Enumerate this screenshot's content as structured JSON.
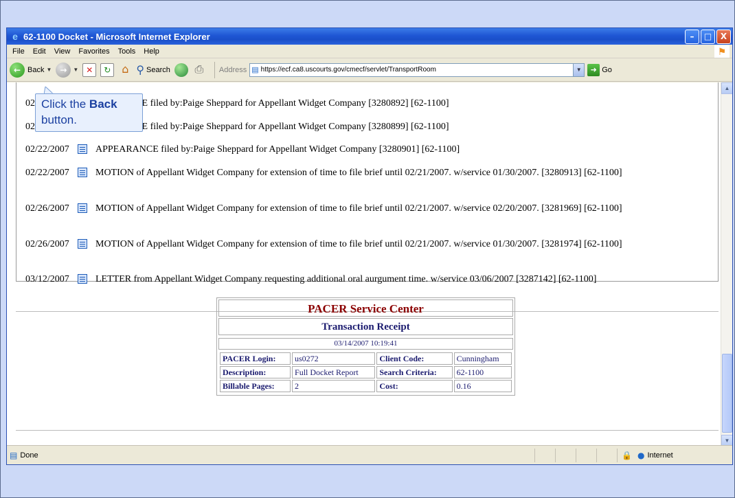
{
  "window": {
    "title": "62-1100 Docket - Microsoft Internet Explorer",
    "minimize": "–",
    "maximize": "□",
    "close": "X"
  },
  "menu": [
    "File",
    "Edit",
    "View",
    "Favorites",
    "Tools",
    "Help"
  ],
  "toolbar": {
    "back_label": "Back",
    "search_label": "Search",
    "address_label": "Address",
    "address_value": "https://ecf.ca8.uscourts.gov/cmecf/servlet/TransportRoom",
    "go_label": "Go"
  },
  "callout": {
    "line1_prefix": "Click the ",
    "line1_bold": "Back",
    "line2": "button."
  },
  "entries": [
    {
      "date": "02/",
      "text": "ANCE filed by:Paige Sheppard for Appellant Widget Company [3280892] [62-1100]"
    },
    {
      "date": "02/",
      "text": "ANCE filed by:Paige Sheppard for Appellant Widget Company [3280899] [62-1100]"
    },
    {
      "date": "02/22/2007",
      "text": "APPEARANCE filed by:Paige Sheppard for Appellant Widget Company [3280901] [62-1100]"
    },
    {
      "date": "02/22/2007",
      "text": "MOTION of Appellant Widget Company for extension of time to file brief until 02/21/2007. w/service 01/30/2007. [3280913] [62-1100]"
    },
    {
      "date": "02/26/2007",
      "text": "MOTION of Appellant Widget Company for extension of time to file brief until 02/21/2007. w/service 02/20/2007. [3281969] [62-1100]"
    },
    {
      "date": "02/26/2007",
      "text": "MOTION of Appellant Widget Company for extension of time to file brief until 02/21/2007. w/service 01/30/2007. [3281974] [62-1100]"
    },
    {
      "date": "03/12/2007",
      "text": "LETTER from Appellant Widget Company requesting additional oral aurgument time. w/service 03/06/2007 [3287142] [62-1100]"
    }
  ],
  "receipt": {
    "title": "PACER Service Center",
    "subtitle": "Transaction Receipt",
    "timestamp": "03/14/2007 10:19:41",
    "rows": [
      {
        "l1": "PACER Login:",
        "v1": "us0272",
        "l2": "Client Code:",
        "v2": "Cunningham"
      },
      {
        "l1": "Description:",
        "v1": "Full Docket Report",
        "l2": "Search Criteria:",
        "v2": "62-1100"
      },
      {
        "l1": "Billable Pages:",
        "v1": "2",
        "l2": "Cost:",
        "v2": "0.16"
      }
    ]
  },
  "status": {
    "done": "Done",
    "zone": "Internet"
  },
  "colors": {
    "slide_bg": "#ccd9f7",
    "titlebar": "#1f56d4",
    "receipt_title": "#8b0000",
    "receipt_text": "#1a1a6e",
    "callout_text": "#1a3fa0"
  }
}
